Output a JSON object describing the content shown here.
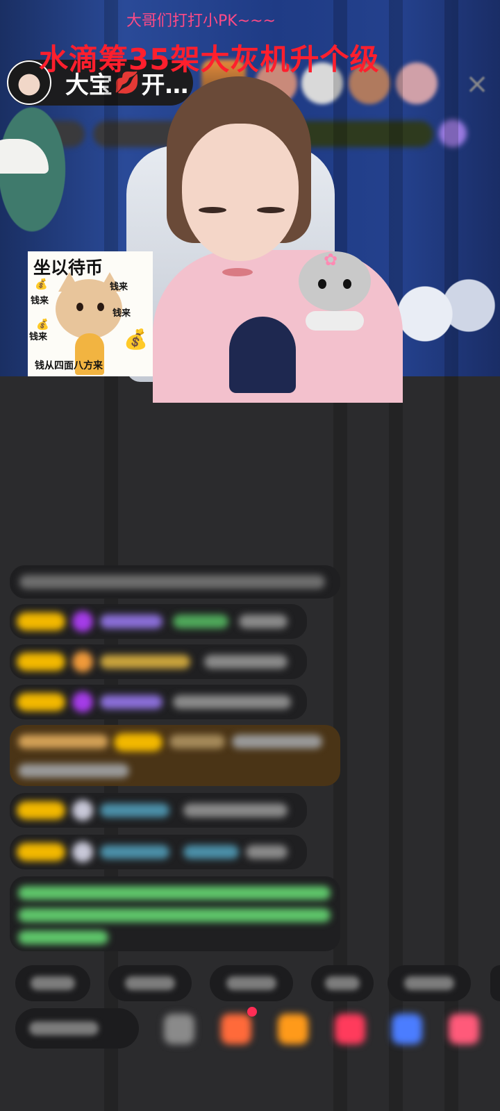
{
  "header": {
    "host_name": "大宝",
    "host_name_suffix": "开…",
    "lips_emoji": "💋",
    "close_icon": "×"
  },
  "stream": {
    "subtitle": "大哥们打打小PK~~~",
    "title": "水滴筹35架大灰机升个级",
    "sticker": {
      "title": "坐以待币",
      "labels": [
        "钱来",
        "钱来",
        "钱来",
        "钱来"
      ],
      "bottom_text": "钱从四面八方来",
      "bag_glyph": "💰"
    },
    "kitten_flower": "✿"
  },
  "colors": {
    "accent_pink": "#ff4a86",
    "title_red": "#ff1f2d",
    "badge_yellow": "#f2b800",
    "purple_gem": "#a53ce8",
    "chat_green": "#5ec56a"
  }
}
